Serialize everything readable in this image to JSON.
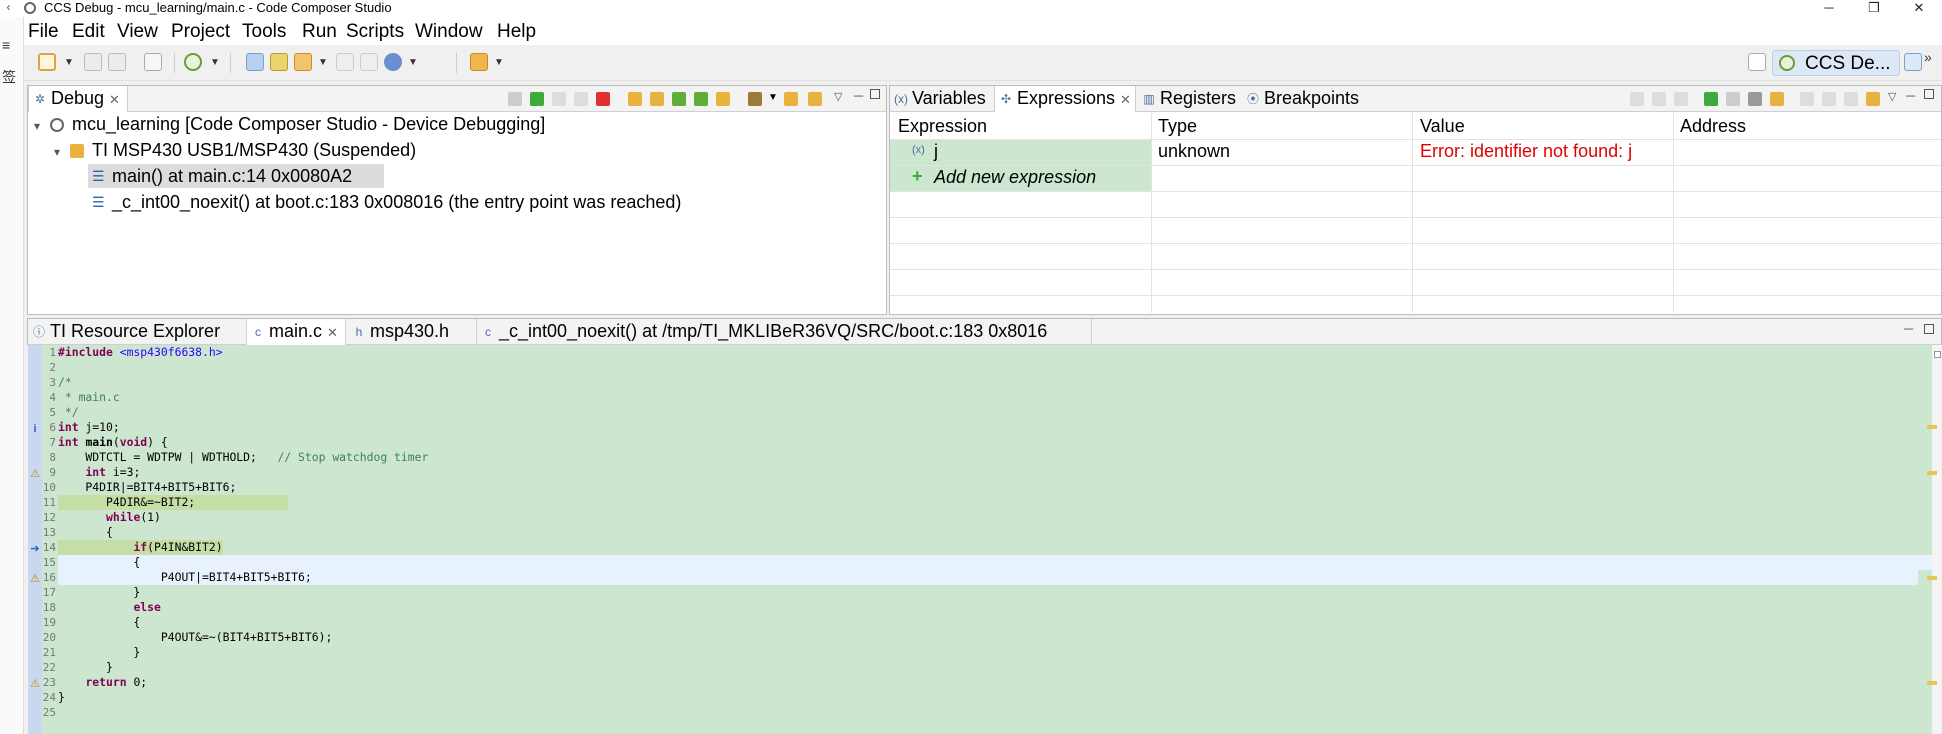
{
  "window": {
    "title": "CCS Debug - mcu_learning/main.c - Code Composer Studio",
    "min_glyph": "─",
    "max_glyph": "❐",
    "close_glyph": "✕"
  },
  "menu": [
    "File",
    "Edit",
    "View",
    "Project",
    "Tools",
    "Run",
    "Scripts",
    "Window",
    "Help"
  ],
  "left_strip": {
    "glyph1": "≡",
    "glyph2": "签"
  },
  "perspective": {
    "label": "CCS De...",
    "overflow": "»"
  },
  "debug_view": {
    "tab_label": "Debug",
    "tree": [
      {
        "label": "mcu_learning [Code Composer Studio - Device Debugging]"
      },
      {
        "label": "TI MSP430 USB1/MSP430 (Suspended)"
      },
      {
        "label": "main() at main.c:14 0x0080A2"
      },
      {
        "label": "_c_int00_noexit() at boot.c:183 0x008016  (the entry point was reached)"
      }
    ]
  },
  "expressions_view": {
    "tabs": [
      "Variables",
      "Expressions",
      "Registers",
      "Breakpoints"
    ],
    "columns": [
      "Expression",
      "Type",
      "Value",
      "Address"
    ],
    "rows": [
      {
        "expression": "j",
        "type": "unknown",
        "value": "Error: identifier not found: j",
        "address": ""
      }
    ],
    "add_label": "Add new expression",
    "error_color": "#e00000"
  },
  "editor": {
    "tabs": [
      "TI Resource Explorer",
      "main.c",
      "msp430.h",
      "_c_int00_noexit() at /tmp/TI_MKLIBeR36VQ/SRC/boot.c:183 0x8016"
    ],
    "background": "#cde6d0",
    "lines": [
      "#include <msp430f6638.h>",
      "",
      "/*",
      " * main.c",
      " */",
      "int j=10;",
      "int main(void) {",
      "    WDTCTL = WDTPW | WDTHOLD;   // Stop watchdog timer",
      "    int i=3;",
      "    P4DIR|=BIT4+BIT5+BIT6;",
      "       P4DIR&=~BIT2;",
      "       while(1)",
      "       {",
      "           if(P4IN&BIT2)",
      "           {",
      "               P4OUT|=BIT4+BIT5+BIT6;",
      "           }",
      "           else",
      "           {",
      "               P4OUT&=~(BIT4+BIT5+BIT6);",
      "           }",
      "       }",
      "    return 0;",
      "}",
      ""
    ]
  }
}
